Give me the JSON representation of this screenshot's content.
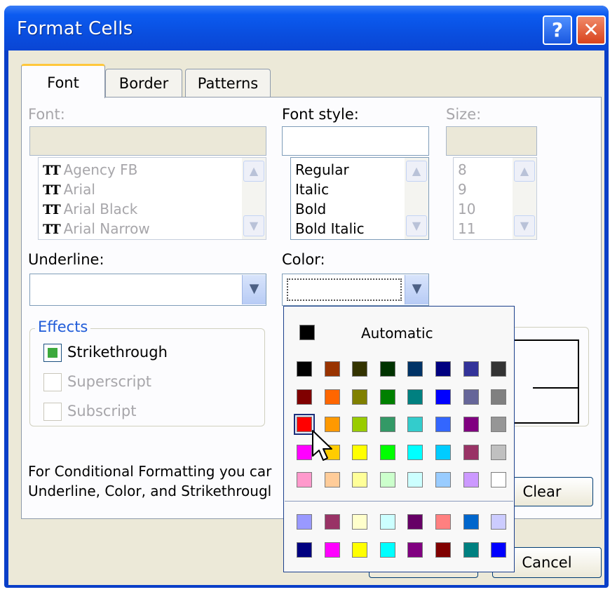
{
  "window": {
    "title": "Format Cells",
    "help_icon": "?",
    "close_icon": "✕"
  },
  "tabs": [
    {
      "label": "Font",
      "selected": true
    },
    {
      "label": "Border",
      "selected": false
    },
    {
      "label": "Patterns",
      "selected": false
    }
  ],
  "font": {
    "label": "Font:",
    "value": "",
    "items": [
      "Agency FB",
      "Arial",
      "Arial Black",
      "Arial Narrow"
    ],
    "item_icon": "truetype-font-icon"
  },
  "font_style": {
    "label": "Font style:",
    "value": "",
    "items": [
      "Regular",
      "Italic",
      "Bold",
      "Bold Italic"
    ]
  },
  "size": {
    "label": "Size:",
    "value": "",
    "items": [
      "8",
      "9",
      "10",
      "11"
    ]
  },
  "underline": {
    "label": "Underline:",
    "value": ""
  },
  "color": {
    "label": "Color:",
    "value": ""
  },
  "effects": {
    "label": "Effects",
    "strikethrough": {
      "label": "Strikethrough",
      "state": "indeterminate"
    },
    "superscript": {
      "label": "Superscript",
      "enabled": false
    },
    "subscript": {
      "label": "Subscript",
      "enabled": false
    }
  },
  "note": {
    "line1": "For Conditional Formatting you car",
    "line2": "Underline, Color, and Strikethrougl"
  },
  "buttons": {
    "clear": "Clear",
    "cancel": "Cancel"
  },
  "palette": {
    "automatic_label": "Automatic",
    "automatic_color": "#000000",
    "selected_color": "#ff0000",
    "rows": [
      [
        "#000000",
        "#993300",
        "#333300",
        "#003300",
        "#003366",
        "#000080",
        "#333399",
        "#333333"
      ],
      [
        "#800000",
        "#ff6600",
        "#808000",
        "#008000",
        "#008080",
        "#0000ff",
        "#666699",
        "#808080"
      ],
      [
        "#ff0000",
        "#ff9900",
        "#99cc00",
        "#339966",
        "#33cccc",
        "#3366ff",
        "#800080",
        "#969696"
      ],
      [
        "#ff00ff",
        "#ffcc00",
        "#ffff00",
        "#00ff00",
        "#00ffff",
        "#00ccff",
        "#993366",
        "#c0c0c0"
      ],
      [
        "#ff99cc",
        "#ffcc99",
        "#ffff99",
        "#ccffcc",
        "#ccffff",
        "#99ccff",
        "#cc99ff",
        "#ffffff"
      ]
    ],
    "chart_rows": [
      [
        "#9999ff",
        "#993366",
        "#ffffcc",
        "#ccffff",
        "#660066",
        "#ff8080",
        "#0066cc",
        "#ccccff"
      ],
      [
        "#000080",
        "#ff00ff",
        "#ffff00",
        "#00ffff",
        "#800080",
        "#800000",
        "#008080",
        "#0000ff"
      ]
    ]
  }
}
